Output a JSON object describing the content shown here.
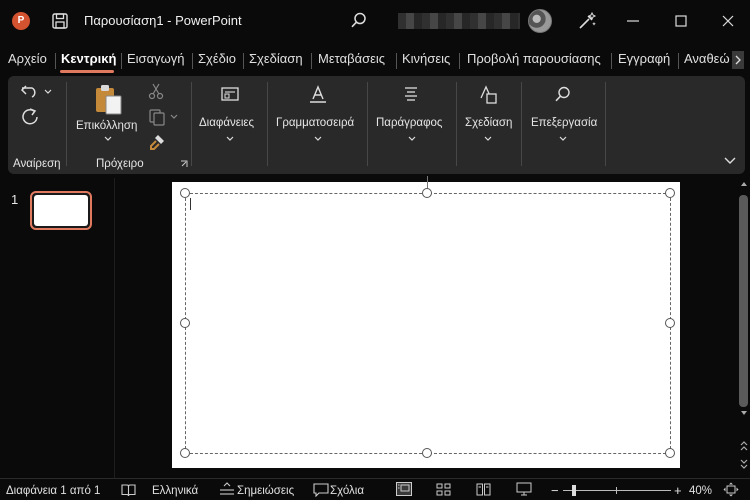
{
  "titlebar": {
    "app_logo": "P",
    "title": "Παρουσίαση1  -  PowerPoint",
    "icons": [
      "powerpoint-logo",
      "save-icon",
      "search-icon",
      "designer-icon",
      "minimize-icon",
      "maximize-icon",
      "close-icon"
    ]
  },
  "tabs": [
    "Αρχείο",
    "Κεντρική",
    "Εισαγωγή",
    "Σχέδιο",
    "Σχεδίαση",
    "Μεταβάσεις",
    "Κινήσεις",
    "Προβολή παρουσίασης",
    "Εγγραφή",
    "Αναθεώ"
  ],
  "active_tab": "Κεντρική",
  "ribbon": {
    "undo_group": "Αναίρεση",
    "paste_label": "Επικόλληση",
    "clipboard_group": "Πρόχειρο",
    "slides_label": "Διαφάνειες",
    "font_label": "Γραμματοσειρά",
    "paragraph_label": "Παράγραφος",
    "drawing_label": "Σχεδίαση",
    "editing_label": "Επεξεργασία"
  },
  "thumbnails": [
    {
      "number": "1"
    }
  ],
  "statusbar": {
    "slide_info": "Διαφάνεια 1 από 1",
    "language": "Ελληνικά",
    "notes": "Σημειώσεις",
    "comments": "Σχόλια",
    "zoom": "40%",
    "zoom_fraction": 0.1
  },
  "colors": {
    "accent": "#e07a5f",
    "ribbon_bg": "#292929",
    "window_bg": "#0a0a0a",
    "slide_bg": "#ffffff"
  }
}
